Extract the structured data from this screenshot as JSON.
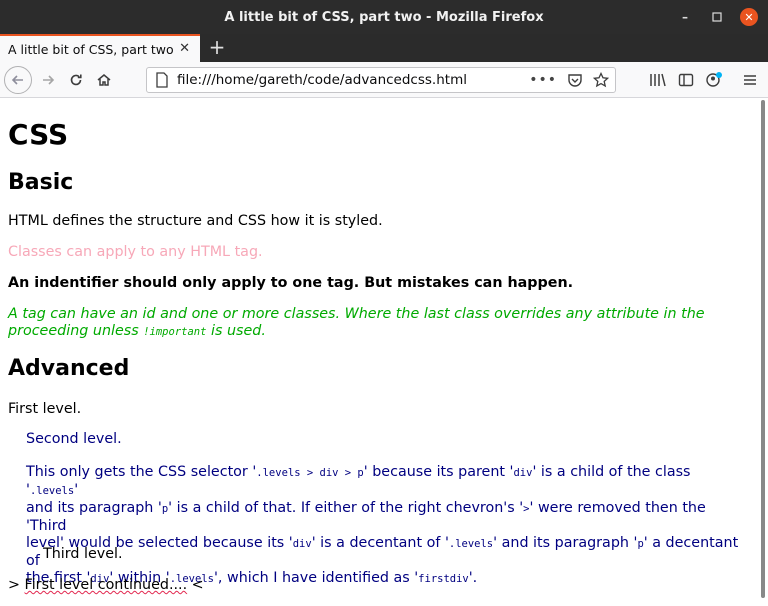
{
  "window": {
    "title": "A little bit of CSS, part two - Mozilla Firefox"
  },
  "tab": {
    "label": "A little bit of CSS, part two"
  },
  "urlbar": {
    "url": "file:///home/gareth/code/advancedcss.html"
  },
  "page": {
    "h1": "CSS",
    "h2_basic": "Basic",
    "p1": "HTML defines the structure and CSS how it is styled.",
    "p_classes": "Classes can apply to any HTML tag.",
    "p_identifier": "An indentifier should only apply to one tag. But mistakes can happen.",
    "p_tag_1": "A tag can have an id and one or more classes. Where the last class overrides any attribute in the",
    "p_tag_2a": "proceeding unless ",
    "p_tag_code": "!important",
    "p_tag_2b": " is used.",
    "h2_advanced": "Advanced",
    "first_level": "First level.",
    "second_level": "Second level.",
    "expl": {
      "l1a": "This only gets the CSS selector '",
      "c1": ".levels > div > p",
      "l1b": "' because its parent '",
      "c2": "div",
      "l1c": "' is a child of the class '",
      "c3": ".levels",
      "l1d": "'",
      "l2a": "and its paragraph '",
      "c4": "p",
      "l2b": "' is a child of that. If either of the right chevron's '",
      "c5": ">",
      "l2c": "' were removed then the 'Third",
      "l3a": "level' would be selected because its '",
      "c6": "div",
      "l3b": "' is a decentant of '",
      "c7": ".levels",
      "l3c": "' and its paragraph '",
      "c8": "p",
      "l3d": "' a decentant of",
      "l4a": "the first '",
      "c9": "div",
      "l4b": "' within '",
      "c10": ".levels",
      "l4c": "', which I have identified as '",
      "c11": "firstdiv",
      "l4d": "'."
    },
    "third_level": "Third level.",
    "first_continued_a": "> ",
    "first_continued_b": "First level continued....",
    "first_continued_c": " <"
  },
  "colors": {
    "accent": "#e95420",
    "pink": "#f7a8b8",
    "green": "#00aa00",
    "navy": "#000080"
  }
}
